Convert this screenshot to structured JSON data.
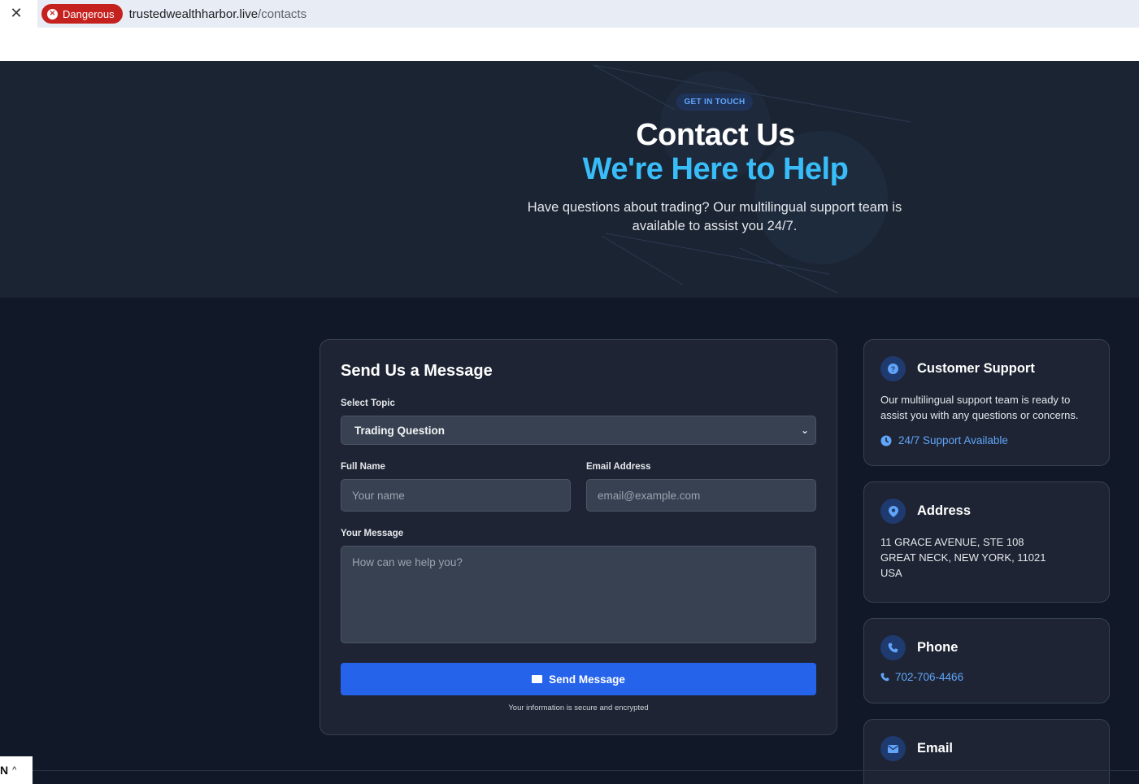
{
  "browser": {
    "close_glyph": "✕",
    "warning_label": "Dangerous",
    "url_domain": "trustedwealthharbor.live",
    "url_path": "/contacts"
  },
  "hero": {
    "badge": "GET IN TOUCH",
    "title": "Contact Us",
    "title_accent": "We're Here to Help",
    "subtitle": "Have questions about trading? Our multilingual support team is available to assist you 24/7."
  },
  "form": {
    "title": "Send Us a Message",
    "topic_label": "Select Topic",
    "topic_value": "Trading Question",
    "name_label": "Full Name",
    "name_placeholder": "Your name",
    "email_label": "Email Address",
    "email_placeholder": "email@example.com",
    "message_label": "Your Message",
    "message_placeholder": "How can we help you?",
    "submit_label": "Send Message",
    "security_note": "Your information is secure and encrypted"
  },
  "support": {
    "title": "Customer Support",
    "text": "Our multilingual support team is ready to assist you with any questions or concerns.",
    "availability": "24/7 Support Available"
  },
  "address": {
    "title": "Address",
    "line1": "11 GRACE AVENUE, STE 108",
    "line2": "GREAT NECK, NEW YORK, 11021",
    "line3": "USA"
  },
  "phone": {
    "title": "Phone",
    "number": "702-706-4466"
  },
  "email": {
    "title": "Email"
  },
  "language": {
    "code": "N",
    "chevron": "^"
  },
  "colors": {
    "accent_blue": "#2563eb",
    "accent_cyan": "#38bdf8",
    "danger_red": "#c5221f",
    "page_bg": "#111827"
  }
}
